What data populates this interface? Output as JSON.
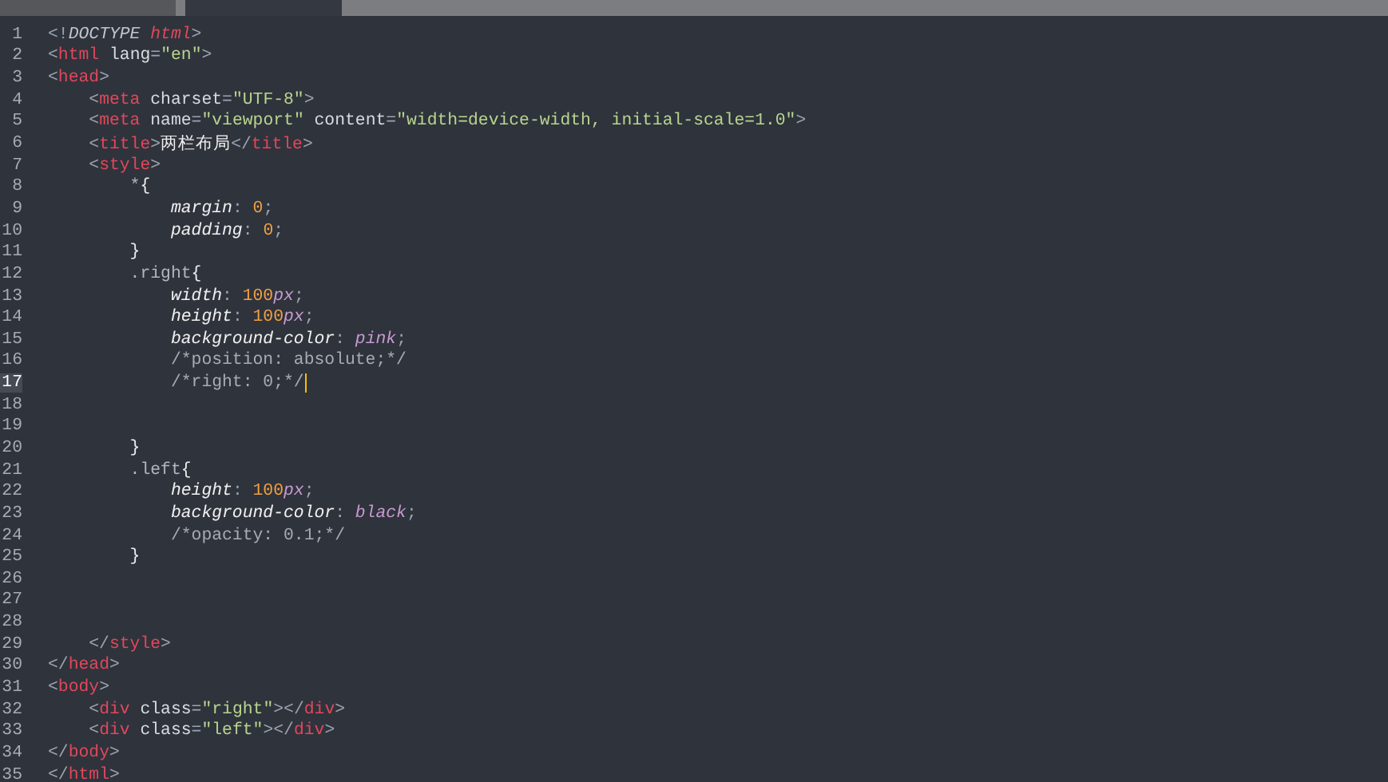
{
  "tabs": [
    {
      "selected": false
    },
    {
      "selected": true
    }
  ],
  "lines": [
    {
      "n": "1",
      "current": false,
      "tokens": [
        {
          "t": "<!",
          "kind": "p"
        },
        {
          "t": "DOCTYPE ",
          "kind": "doc"
        },
        {
          "t": "html",
          "kind": "tagi"
        },
        {
          "t": ">",
          "kind": "p"
        }
      ]
    },
    {
      "n": "2",
      "current": false,
      "tokens": [
        {
          "t": "<",
          "kind": "p"
        },
        {
          "t": "html",
          "kind": "tag"
        },
        {
          "t": " lang",
          "kind": "attr"
        },
        {
          "t": "=",
          "kind": "p"
        },
        {
          "t": "\"en\"",
          "kind": "str"
        },
        {
          "t": ">",
          "kind": "p"
        }
      ]
    },
    {
      "n": "3",
      "current": false,
      "tokens": [
        {
          "t": "<",
          "kind": "p"
        },
        {
          "t": "head",
          "kind": "tag"
        },
        {
          "t": ">",
          "kind": "p"
        }
      ]
    },
    {
      "n": "4",
      "current": false,
      "tokens": [
        {
          "t": "    <",
          "kind": "p"
        },
        {
          "t": "meta",
          "kind": "tag"
        },
        {
          "t": " charset",
          "kind": "attr"
        },
        {
          "t": "=",
          "kind": "p"
        },
        {
          "t": "\"UTF-8\"",
          "kind": "str"
        },
        {
          "t": ">",
          "kind": "p"
        }
      ]
    },
    {
      "n": "5",
      "current": false,
      "tokens": [
        {
          "t": "    <",
          "kind": "p"
        },
        {
          "t": "meta",
          "kind": "tag"
        },
        {
          "t": " name",
          "kind": "attr"
        },
        {
          "t": "=",
          "kind": "p"
        },
        {
          "t": "\"viewport\"",
          "kind": "str"
        },
        {
          "t": " content",
          "kind": "attr"
        },
        {
          "t": "=",
          "kind": "p"
        },
        {
          "t": "\"width=device-width, initial-scale=1.0\"",
          "kind": "str"
        },
        {
          "t": ">",
          "kind": "p"
        }
      ]
    },
    {
      "n": "6",
      "current": false,
      "tokens": [
        {
          "t": "    <",
          "kind": "p"
        },
        {
          "t": "title",
          "kind": "tag"
        },
        {
          "t": ">",
          "kind": "p"
        },
        {
          "t": "两栏布局",
          "kind": "text"
        },
        {
          "t": "</",
          "kind": "p"
        },
        {
          "t": "title",
          "kind": "tag"
        },
        {
          "t": ">",
          "kind": "p"
        }
      ]
    },
    {
      "n": "7",
      "current": false,
      "tokens": [
        {
          "t": "    <",
          "kind": "p"
        },
        {
          "t": "style",
          "kind": "tag"
        },
        {
          "t": ">",
          "kind": "p"
        }
      ]
    },
    {
      "n": "8",
      "current": false,
      "tokens": [
        {
          "t": "        *",
          "kind": "sel"
        },
        {
          "t": "{",
          "kind": "text"
        }
      ]
    },
    {
      "n": "9",
      "current": false,
      "tokens": [
        {
          "t": "            margin",
          "kind": "prop"
        },
        {
          "t": ": ",
          "kind": "p"
        },
        {
          "t": "0",
          "kind": "num"
        },
        {
          "t": ";",
          "kind": "p"
        }
      ]
    },
    {
      "n": "10",
      "current": false,
      "tokens": [
        {
          "t": "            padding",
          "kind": "prop"
        },
        {
          "t": ": ",
          "kind": "p"
        },
        {
          "t": "0",
          "kind": "num"
        },
        {
          "t": ";",
          "kind": "p"
        }
      ]
    },
    {
      "n": "11",
      "current": false,
      "tokens": [
        {
          "t": "        }",
          "kind": "text"
        }
      ]
    },
    {
      "n": "12",
      "current": false,
      "tokens": [
        {
          "t": "        .right",
          "kind": "sel"
        },
        {
          "t": "{",
          "kind": "text"
        }
      ]
    },
    {
      "n": "13",
      "current": false,
      "tokens": [
        {
          "t": "            width",
          "kind": "prop"
        },
        {
          "t": ": ",
          "kind": "p"
        },
        {
          "t": "100",
          "kind": "num"
        },
        {
          "t": "px",
          "kind": "unit"
        },
        {
          "t": ";",
          "kind": "p"
        }
      ]
    },
    {
      "n": "14",
      "current": false,
      "tokens": [
        {
          "t": "            height",
          "kind": "prop"
        },
        {
          "t": ": ",
          "kind": "p"
        },
        {
          "t": "100",
          "kind": "num"
        },
        {
          "t": "px",
          "kind": "unit"
        },
        {
          "t": ";",
          "kind": "p"
        }
      ]
    },
    {
      "n": "15",
      "current": false,
      "tokens": [
        {
          "t": "            background-color",
          "kind": "prop"
        },
        {
          "t": ": ",
          "kind": "p"
        },
        {
          "t": "pink",
          "kind": "unit"
        },
        {
          "t": ";",
          "kind": "p"
        }
      ]
    },
    {
      "n": "16",
      "current": false,
      "tokens": [
        {
          "t": "            /*position: absolute;*/",
          "kind": "comment"
        }
      ]
    },
    {
      "n": "17",
      "current": true,
      "tokens": [
        {
          "t": "            /*right: 0;*/",
          "kind": "comment"
        }
      ]
    },
    {
      "n": "18",
      "current": false
    },
    {
      "n": "19",
      "current": false
    },
    {
      "n": "20",
      "current": false,
      "tokens": [
        {
          "t": "        }",
          "kind": "text"
        }
      ]
    },
    {
      "n": "21",
      "current": false,
      "tokens": [
        {
          "t": "        .left",
          "kind": "sel"
        },
        {
          "t": "{",
          "kind": "text"
        }
      ]
    },
    {
      "n": "22",
      "current": false,
      "tokens": [
        {
          "t": "            height",
          "kind": "prop"
        },
        {
          "t": ": ",
          "kind": "p"
        },
        {
          "t": "100",
          "kind": "num"
        },
        {
          "t": "px",
          "kind": "unit"
        },
        {
          "t": ";",
          "kind": "p"
        }
      ]
    },
    {
      "n": "23",
      "current": false,
      "tokens": [
        {
          "t": "            background-color",
          "kind": "prop"
        },
        {
          "t": ": ",
          "kind": "p"
        },
        {
          "t": "black",
          "kind": "unit"
        },
        {
          "t": ";",
          "kind": "p"
        }
      ]
    },
    {
      "n": "24",
      "current": false,
      "tokens": [
        {
          "t": "            /*opacity: 0.1;*/",
          "kind": "comment"
        }
      ]
    },
    {
      "n": "25",
      "current": false,
      "tokens": [
        {
          "t": "        }",
          "kind": "text"
        }
      ]
    },
    {
      "n": "26",
      "current": false
    },
    {
      "n": "27",
      "current": false
    },
    {
      "n": "28",
      "current": false
    },
    {
      "n": "29",
      "current": false,
      "tokens": [
        {
          "t": "    </",
          "kind": "p"
        },
        {
          "t": "style",
          "kind": "tag"
        },
        {
          "t": ">",
          "kind": "p"
        }
      ]
    },
    {
      "n": "30",
      "current": false,
      "tokens": [
        {
          "t": "</",
          "kind": "p"
        },
        {
          "t": "head",
          "kind": "tag"
        },
        {
          "t": ">",
          "kind": "p"
        }
      ]
    },
    {
      "n": "31",
      "current": false,
      "tokens": [
        {
          "t": "<",
          "kind": "p"
        },
        {
          "t": "body",
          "kind": "tag"
        },
        {
          "t": ">",
          "kind": "p"
        }
      ]
    },
    {
      "n": "32",
      "current": false,
      "tokens": [
        {
          "t": "    <",
          "kind": "p"
        },
        {
          "t": "div",
          "kind": "tag"
        },
        {
          "t": " class",
          "kind": "attr"
        },
        {
          "t": "=",
          "kind": "p"
        },
        {
          "t": "\"right\"",
          "kind": "str"
        },
        {
          "t": "></",
          "kind": "p"
        },
        {
          "t": "div",
          "kind": "tag"
        },
        {
          "t": ">",
          "kind": "p"
        }
      ]
    },
    {
      "n": "33",
      "current": false,
      "tokens": [
        {
          "t": "    <",
          "kind": "p"
        },
        {
          "t": "div",
          "kind": "tag"
        },
        {
          "t": " class",
          "kind": "attr"
        },
        {
          "t": "=",
          "kind": "p"
        },
        {
          "t": "\"left\"",
          "kind": "str"
        },
        {
          "t": "></",
          "kind": "p"
        },
        {
          "t": "div",
          "kind": "tag"
        },
        {
          "t": ">",
          "kind": "p"
        }
      ]
    },
    {
      "n": "34",
      "current": false,
      "tokens": [
        {
          "t": "</",
          "kind": "p"
        },
        {
          "t": "body",
          "kind": "tag"
        },
        {
          "t": ">",
          "kind": "p"
        }
      ]
    },
    {
      "n": "35",
      "current": false,
      "tokens": [
        {
          "t": "</",
          "kind": "p"
        },
        {
          "t": "html",
          "kind": "tag"
        },
        {
          "t": ">",
          "kind": "p"
        }
      ]
    }
  ]
}
